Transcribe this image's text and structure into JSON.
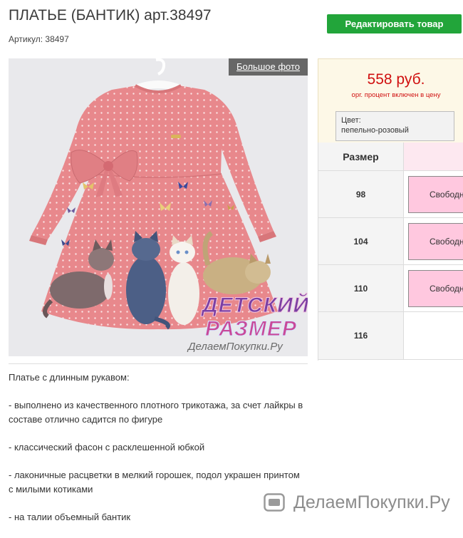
{
  "product": {
    "title": "ПЛАТЬЕ (БАНТИК) арт.38497",
    "article": "Артикул: 38497"
  },
  "actions": {
    "edit_label": "Редактировать товар"
  },
  "gallery": {
    "big_photo_label": "Большое фото",
    "watermark_line1": "ДЕТСКИЙ",
    "watermark_line2": "РАЗМЕР",
    "watermark_site": "ДелаемПокупки.Ру"
  },
  "price": {
    "amount": "558 руб.",
    "note": "орг. процент включен в цену",
    "color_label": "Цвет:",
    "color_value": "пепельно-розовый"
  },
  "sizes": {
    "header": "Размер",
    "rows": [
      {
        "size": "98",
        "status": "Свободн"
      },
      {
        "size": "104",
        "status": "Свободн"
      },
      {
        "size": "110",
        "status": "Свободн"
      },
      {
        "size": "116",
        "status": ""
      }
    ]
  },
  "description": {
    "paragraphs": [
      [
        "Платье с длинным рукавом:"
      ],
      [
        "- выполнено из качественного плотного трикотажа, за счет лайкры в",
        "составе отлично садится по фигуре"
      ],
      [
        "- классический фасон с расклешенной юбкой"
      ],
      [
        "- лаконичные расцветки в мелкий горошек, подол украшен принтом",
        "с милыми котиками"
      ],
      [
        "- на талии объемный бантик"
      ]
    ]
  },
  "footer_watermark": {
    "text": "ДелаемПокупки.Ру",
    "icon": "site-logo-icon"
  },
  "colors": {
    "accent_green": "#22a53a",
    "price_red": "#d01010",
    "pink_cell": "#ffc8df",
    "dress_pink": "#e8888c",
    "panel_bg": "#fdf8e7"
  }
}
